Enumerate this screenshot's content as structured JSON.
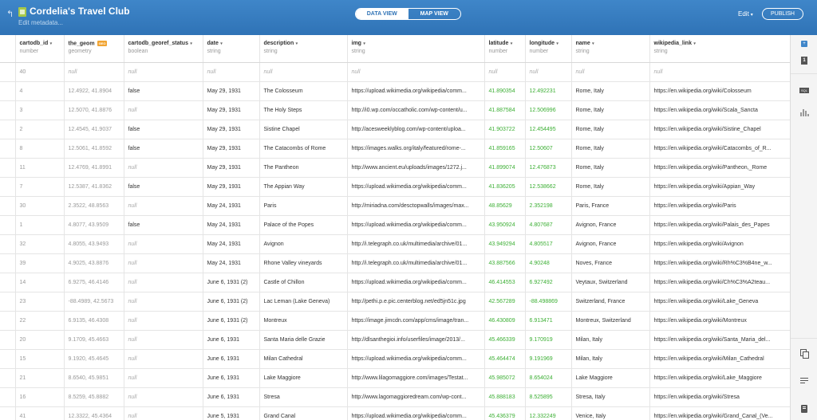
{
  "header": {
    "back_glyph": "↰",
    "dataset_icon": "dataset-icon",
    "title": "Cordelia's Travel Club",
    "edit_metadata": "Edit metadata...",
    "tabs": [
      {
        "label": "DATA VIEW",
        "active": true
      },
      {
        "label": "MAP VIEW",
        "active": false
      }
    ],
    "edit_label": "Edit",
    "edit_caret": "▾",
    "publish_label": "PUBLISH"
  },
  "columns": [
    {
      "name": "",
      "type": ""
    },
    {
      "name": "cartodb_id",
      "type": "number"
    },
    {
      "name": "the_geom",
      "type": "geometry",
      "badge": "GEO"
    },
    {
      "name": "cartodb_georef_status",
      "type": "boolean"
    },
    {
      "name": "date",
      "type": "string"
    },
    {
      "name": "description",
      "type": "string"
    },
    {
      "name": "img",
      "type": "string"
    },
    {
      "name": "latitude",
      "type": "number"
    },
    {
      "name": "longitude",
      "type": "number"
    },
    {
      "name": "name",
      "type": "string"
    },
    {
      "name": "wikipedia_link",
      "type": "string"
    }
  ],
  "rows": [
    [
      "40",
      "null",
      "null",
      "null",
      "null",
      "null",
      "null",
      "null",
      "null",
      "null"
    ],
    [
      "4",
      "12.4922, 41.8904",
      "false",
      "May 29, 1931",
      "The Colosseum",
      "https://upload.wikimedia.org/wikipedia/comm...",
      "41.890354",
      "12.492231",
      "Rome, Italy",
      "https://en.wikipedia.org/wiki/Colosseum"
    ],
    [
      "3",
      "12.5070, 41.8876",
      "null",
      "May 29, 1931",
      "The Holy Steps",
      "http://i0.wp.com/occatholic.com/wp-content/u...",
      "41.887584",
      "12.506996",
      "Rome, Italy",
      "https://en.wikipedia.org/wiki/Scala_Sancta"
    ],
    [
      "2",
      "12.4545, 41.9037",
      "false",
      "May 29, 1931",
      "Sistine Chapel",
      "http://acesweeklyblog.com/wp-content/uploa...",
      "41.903722",
      "12.454495",
      "Rome, Italy",
      "https://en.wikipedia.org/wiki/Sistine_Chapel"
    ],
    [
      "8",
      "12.5061, 41.8592",
      "false",
      "May 29, 1931",
      "The Catacombs of Rome",
      "https://images.walks.org/italy/featured/rome-...",
      "41.859165",
      "12.50607",
      "Rome, Italy",
      "https://en.wikipedia.org/wiki/Catacombs_of_R..."
    ],
    [
      "11",
      "12.4769, 41.8991",
      "null",
      "May 29, 1931",
      "The Pantheon",
      "http://www.ancient.eu/uploads/images/1272.j...",
      "41.899074",
      "12.476873",
      "Rome, Italy",
      "https://en.wikipedia.org/wiki/Pantheon,_Rome"
    ],
    [
      "7",
      "12.5387, 41.8362",
      "false",
      "May 29, 1931",
      "The Appian Way",
      "https://upload.wikimedia.org/wikipedia/comm...",
      "41.836205",
      "12.538662",
      "Rome, Italy",
      "https://en.wikipedia.org/wiki/Appian_Way"
    ],
    [
      "30",
      "2.3522, 48.8563",
      "null",
      "May 24, 1931",
      "Paris",
      "http://miriadna.com/desctopwalls/images/max...",
      "48.85629",
      "2.352198",
      "Paris, France",
      "https://en.wikipedia.org/wiki/Paris"
    ],
    [
      "1",
      "4.8077, 43.9509",
      "false",
      "May 24, 1931",
      "Palace of the Popes",
      "https://upload.wikimedia.org/wikipedia/comm...",
      "43.950924",
      "4.807687",
      "Avignon, France",
      "https://en.wikipedia.org/wiki/Palais_des_Papes"
    ],
    [
      "32",
      "4.8055, 43.9493",
      "null",
      "May 24, 1931",
      "Avignon",
      "http://i.telegraph.co.uk/multimedia/archive/01...",
      "43.949294",
      "4.805517",
      "Avignon, France",
      "https://en.wikipedia.org/wiki/Avignon"
    ],
    [
      "39",
      "4.9025, 43.8876",
      "null",
      "May 24, 1931",
      "Rhone Valley vineyards",
      "http://i.telegraph.co.uk/multimedia/archive/01...",
      "43.887566",
      "4.90248",
      "Noves, France",
      "https://en.wikipedia.org/wiki/Rh%C3%B4ne_w..."
    ],
    [
      "14",
      "6.9275, 46.4146",
      "null",
      "June 6, 1931 (2)",
      "Castle of Chillon",
      "https://upload.wikimedia.org/wikipedia/comm...",
      "46.414553",
      "6.927492",
      "Veytaux, Switzerland",
      "https://en.wikipedia.org/wiki/Ch%C3%A2teau..."
    ],
    [
      "23",
      "-88.4989, 42.5673",
      "null",
      "June 6, 1931 (2)",
      "Lac Leman (Lake Geneva)",
      "http://pethi.p.e.pic.centerblog.net/ed5jn51c.jpg",
      "42.567289",
      "-88.498869",
      "Switzerland, France",
      "https://en.wikipedia.org/wiki/Lake_Geneva"
    ],
    [
      "22",
      "6.9135, 46.4308",
      "null",
      "June 6, 1931 (2)",
      "Montreux",
      "https://image.jimcdn.com/app/cms/image/tran...",
      "46.430809",
      "6.913471",
      "Montreux, Switzerland",
      "https://en.wikipedia.org/wiki/Montreux"
    ],
    [
      "20",
      "9.1709, 45.4663",
      "null",
      "June 6, 1931",
      "Santa Maria delle Grazie",
      "http://dlsanthegioi.info/userfiles/image/2013/...",
      "45.466339",
      "9.170919",
      "Milan, Italy",
      "https://en.wikipedia.org/wiki/Santa_Maria_del..."
    ],
    [
      "15",
      "9.1920, 45.4645",
      "null",
      "June 6, 1931",
      "Milan Cathedral",
      "https://upload.wikimedia.org/wikipedia/comm...",
      "45.464474",
      "9.191969",
      "Milan, Italy",
      "https://en.wikipedia.org/wiki/Milan_Cathedral"
    ],
    [
      "21",
      "8.6540, 45.9851",
      "null",
      "June 6, 1931",
      "Lake Maggiore",
      "http://www.lilagomaggiore.com/images/Testat...",
      "45.985072",
      "8.654024",
      "Lake Maggiore",
      "https://en.wikipedia.org/wiki/Lake_Maggiore"
    ],
    [
      "16",
      "8.5259, 45.8882",
      "null",
      "June 6, 1931",
      "Stresa",
      "http://www.lagomaggioredream.com/wp-cont...",
      "45.888183",
      "8.525895",
      "Stresa, Italy",
      "https://en.wikipedia.org/wiki/Stresa"
    ],
    [
      "41",
      "12.3322, 45.4364",
      "null",
      "June 5, 1931",
      "Grand Canal",
      "https://upload.wikimedia.org/wikipedia/comm...",
      "45.436379",
      "12.332249",
      "Venice, Italy",
      "https://en.wikipedia.org/wiki/Grand_Canal_(Ve..."
    ]
  ],
  "sidebar": {
    "add_glyph": "+",
    "number_glyph": "1",
    "sql_glyph": "SQL",
    "icons": [
      "add-icon",
      "number-icon",
      "sql-icon",
      "chart-icon",
      "copy-icon",
      "comment-icon",
      "document-icon"
    ]
  },
  "colors": {
    "header": "#3f86c9",
    "numeric_value": "#3caf34",
    "null_value": "#aaaaaa",
    "geo_badge": "#f1a432"
  }
}
